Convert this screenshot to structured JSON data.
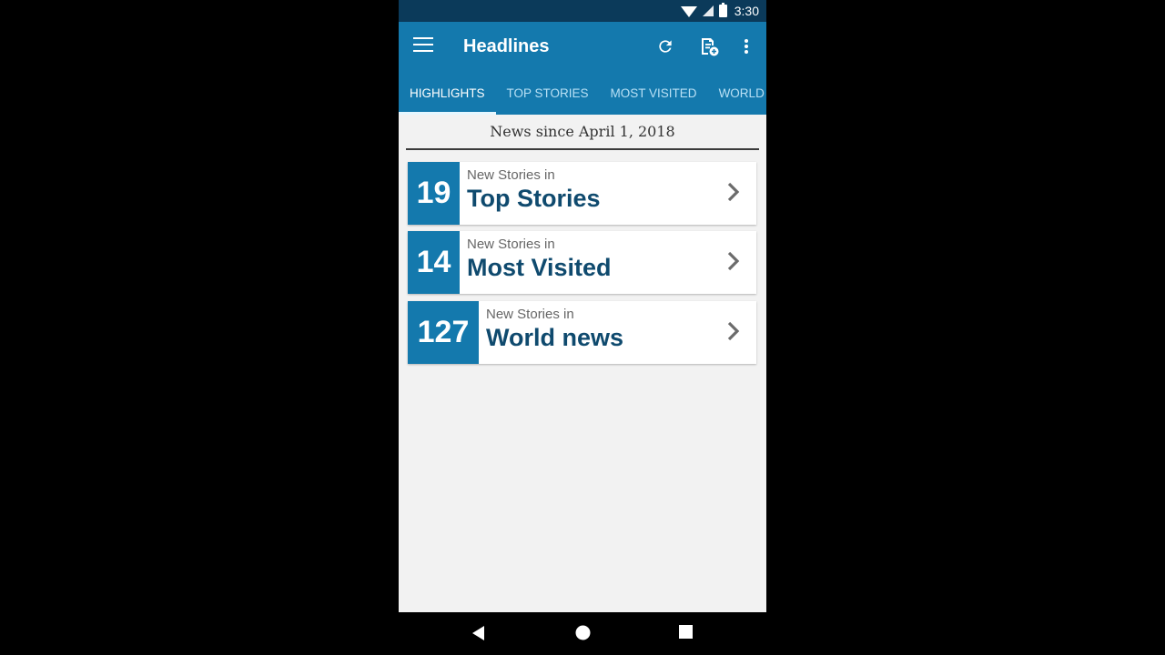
{
  "status_bar": {
    "time": "3:30",
    "icons": [
      "wifi-icon",
      "signal-icon",
      "battery-charging-icon"
    ]
  },
  "toolbar": {
    "title": "Headlines",
    "menu_icon": "hamburger-menu-icon",
    "actions": [
      "refresh-icon",
      "add-feed-icon",
      "more-vert-icon"
    ]
  },
  "tabs": [
    {
      "label": "HIGHLIGHTS",
      "active": true
    },
    {
      "label": "TOP STORIES",
      "active": false
    },
    {
      "label": "MOST VISITED",
      "active": false
    },
    {
      "label": "WORLD NEWS",
      "active": false
    }
  ],
  "main": {
    "since_label": "News since April 1, 2018",
    "cards": [
      {
        "count": "19",
        "subtitle": "New Stories in",
        "section": "Top Stories"
      },
      {
        "count": "14",
        "subtitle": "New Stories in",
        "section": "Most Visited"
      },
      {
        "count": "127",
        "subtitle": "New Stories in",
        "section": "World news"
      }
    ]
  },
  "nav_bar": {
    "buttons": [
      "back-icon",
      "home-icon",
      "recents-icon"
    ]
  },
  "colors": {
    "primary": "#1479ad",
    "status_bar": "#0b3a5a",
    "section_text": "#0f4a6e",
    "background": "#f2f2f2"
  }
}
